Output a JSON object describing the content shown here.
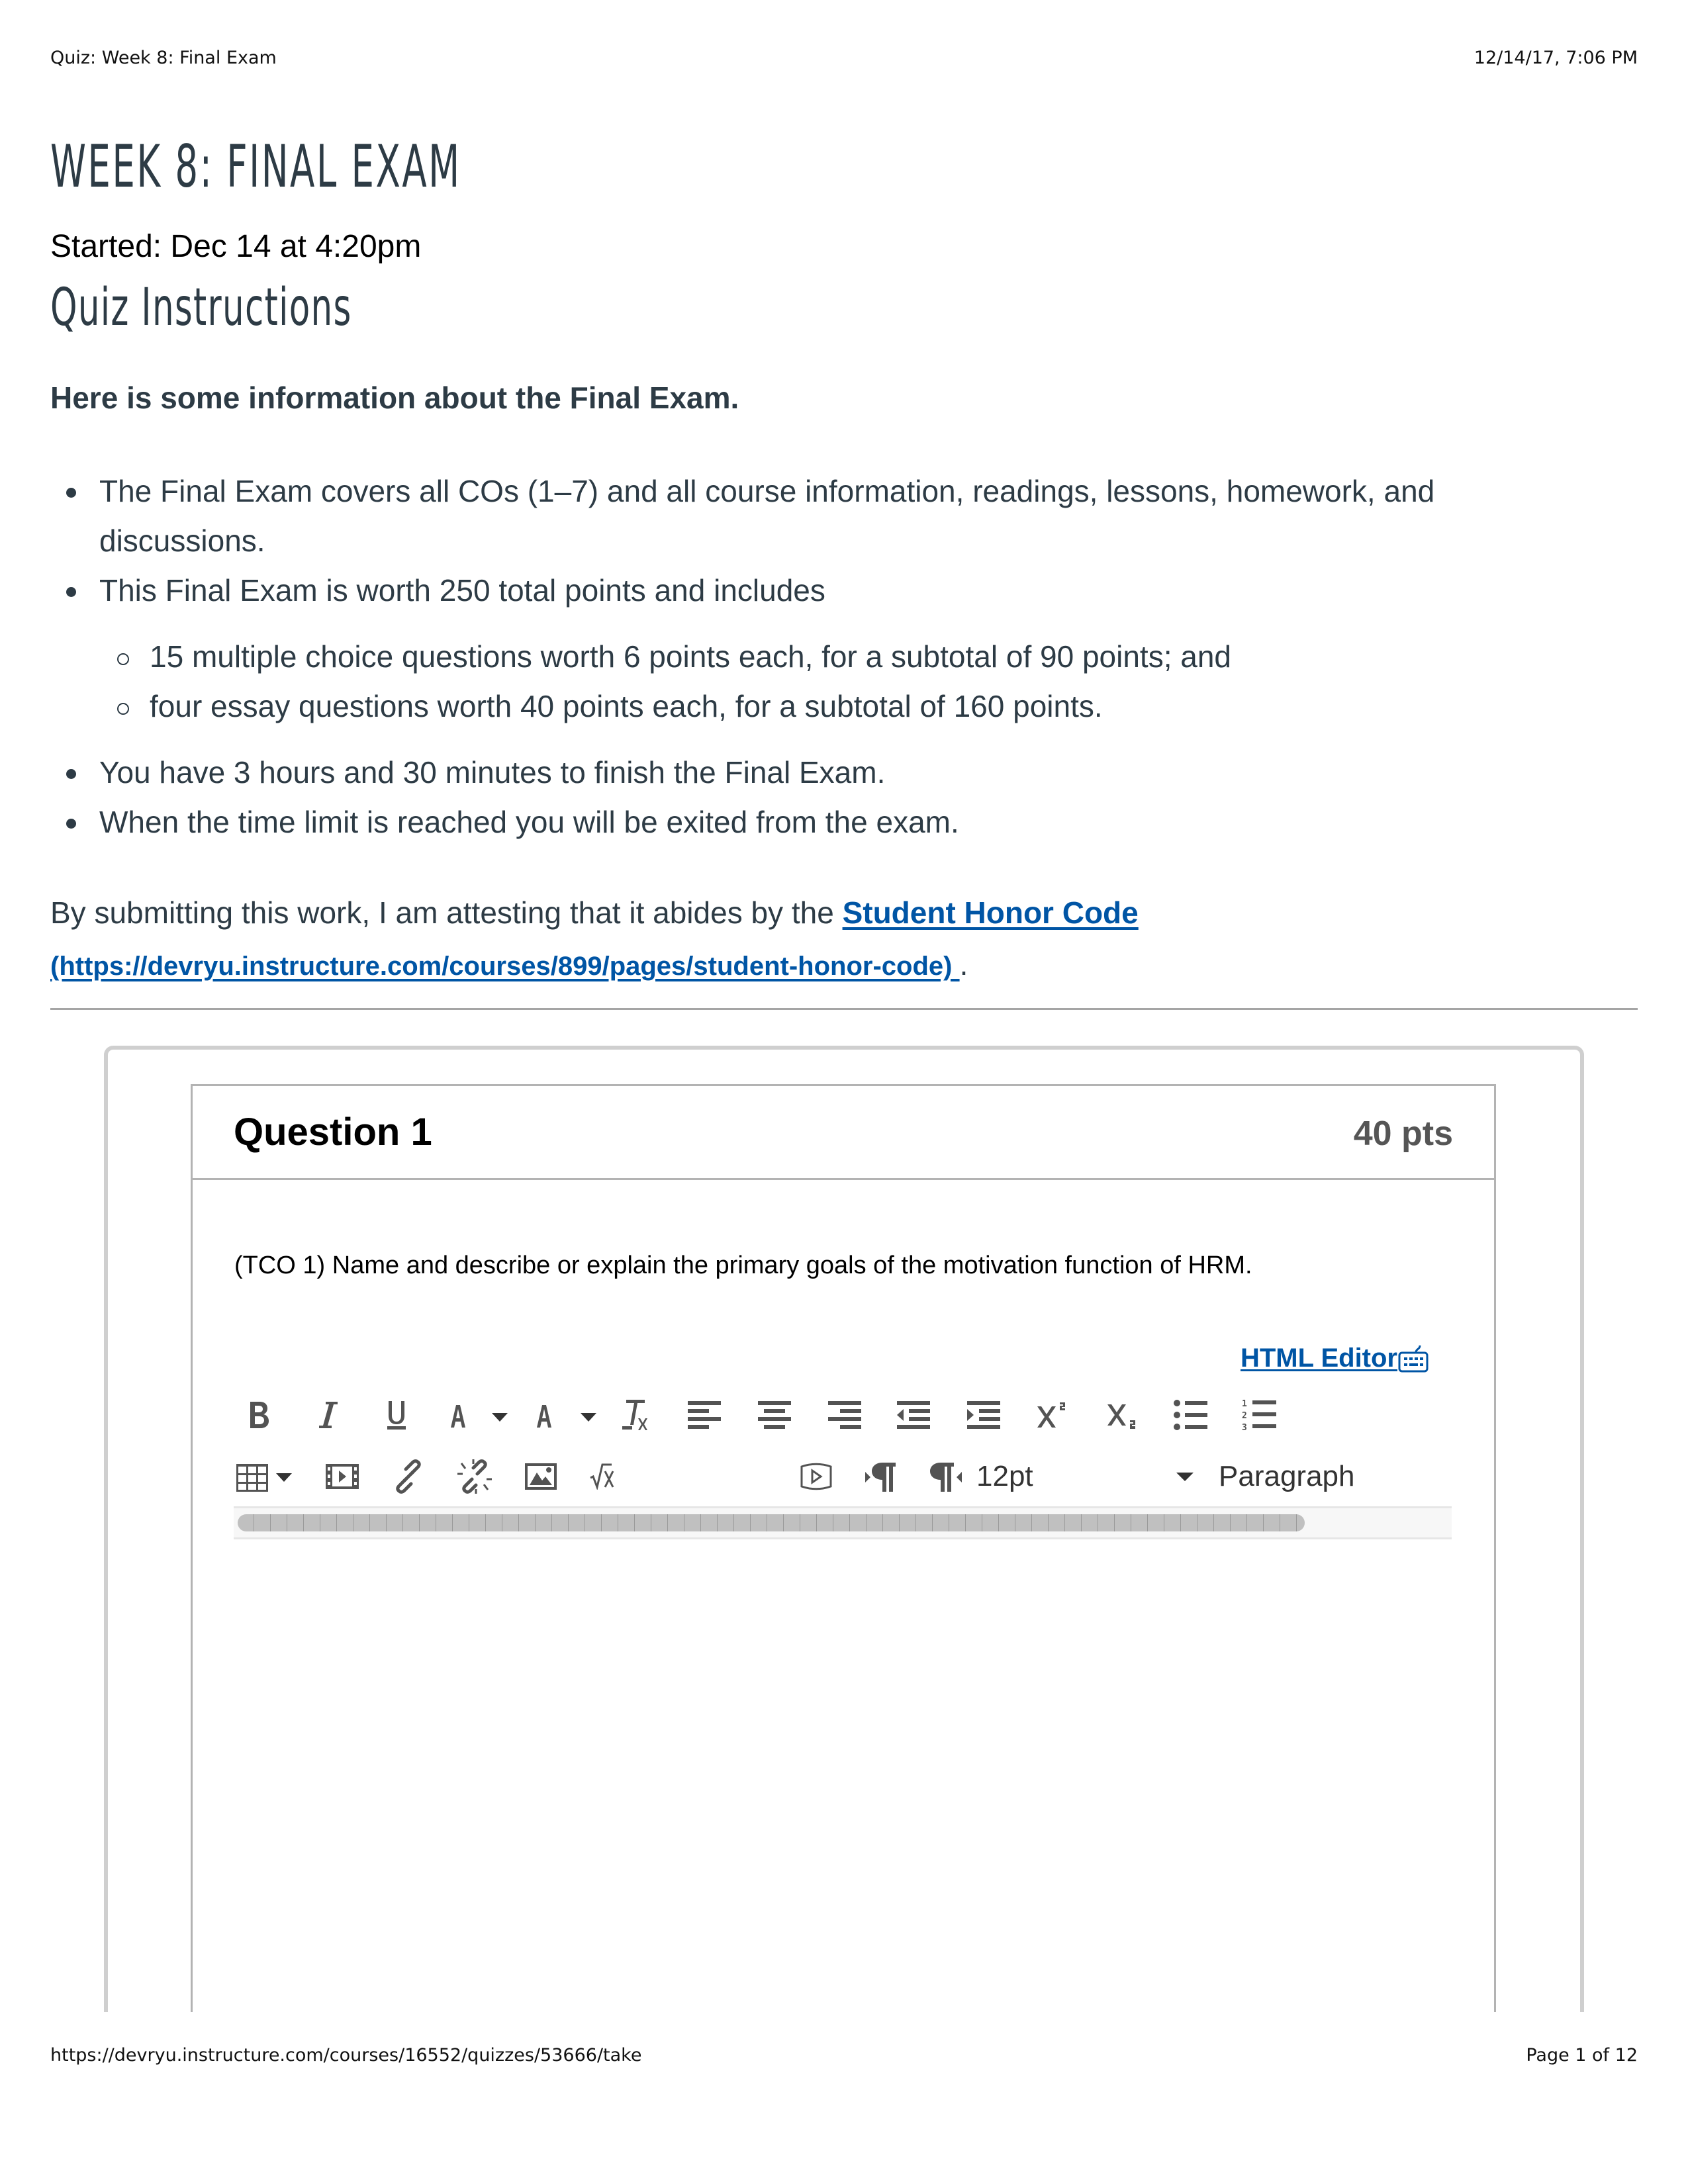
{
  "print_header": {
    "page_title": "Quiz: Week 8: Final Exam",
    "timestamp": "12/14/17, 7:06 PM"
  },
  "quiz": {
    "title": "WEEK 8: FINAL EXAM",
    "started": "Started: Dec 14 at 4:20pm",
    "instructions_heading": "Quiz Instructions",
    "intro": "Here is some information about the Final Exam.",
    "bullets": [
      "The Final Exam covers all COs (1–7) and all course information, readings, lessons, homework, and discussions.",
      "This Final Exam is worth 250 total points and includes",
      "You have 3 hours and 30 minutes to finish the Final Exam.",
      "When the time limit is reached you will be exited from the exam."
    ],
    "sub_bullets": [
      "15 multiple choice questions worth 6 points each, for a subtotal of 90 points; and",
      "four essay questions worth 40 points each, for a subtotal of 160 points."
    ],
    "honor_prefix": "By submitting this work, I am attesting that it abides by the ",
    "honor_link_label": "Student Honor Code",
    "honor_link_url": "(https://devryu.instructure.com/courses/899/pages/student-honor-code) ",
    "honor_suffix": "."
  },
  "question": {
    "title": "Question 1",
    "points": "40 pts",
    "text": "(TCO 1) Name and describe or explain the primary goals of the motivation function of HRM.",
    "html_editor_label": "HTML Editor"
  },
  "editor": {
    "toolbar_row1": [
      {
        "name": "bold-icon",
        "label": "Bold"
      },
      {
        "name": "italic-icon",
        "label": "Italic"
      },
      {
        "name": "underline-icon",
        "label": "Underline"
      },
      {
        "name": "text-color-icon",
        "label": "Text color"
      },
      {
        "name": "background-color-icon",
        "label": "Background color"
      },
      {
        "name": "clear-formatting-icon",
        "label": "Clear formatting"
      },
      {
        "name": "align-left-icon",
        "label": "Align left"
      },
      {
        "name": "align-center-icon",
        "label": "Align center"
      },
      {
        "name": "align-right-icon",
        "label": "Align right"
      },
      {
        "name": "outdent-icon",
        "label": "Decrease indent"
      },
      {
        "name": "indent-icon",
        "label": "Increase indent"
      },
      {
        "name": "superscript-icon",
        "label": "Superscript"
      },
      {
        "name": "subscript-icon",
        "label": "Subscript"
      },
      {
        "name": "bullet-list-icon",
        "label": "Bullet list"
      },
      {
        "name": "numbered-list-icon",
        "label": "Numbered list"
      }
    ],
    "toolbar_row2": [
      {
        "name": "table-icon",
        "label": "Table"
      },
      {
        "name": "media-icon",
        "label": "Embed media"
      },
      {
        "name": "link-icon",
        "label": "Link"
      },
      {
        "name": "unlink-icon",
        "label": "Remove link"
      },
      {
        "name": "image-icon",
        "label": "Image"
      },
      {
        "name": "math-icon",
        "label": "Math equation"
      },
      {
        "name": "record-media-icon",
        "label": "Record media"
      },
      {
        "name": "ltr-icon",
        "label": "Left to right"
      },
      {
        "name": "rtl-icon",
        "label": "Right to left"
      }
    ],
    "font_size": "12pt",
    "block_format": "Paragraph"
  },
  "print_footer": {
    "url": "https://devryu.instructure.com/courses/16552/quizzes/53666/take",
    "page": "Page 1 of 12"
  },
  "colors": {
    "text": "#2d3b45",
    "link": "#0055a5",
    "icon": "#535353",
    "border": "#b3b3b3"
  }
}
